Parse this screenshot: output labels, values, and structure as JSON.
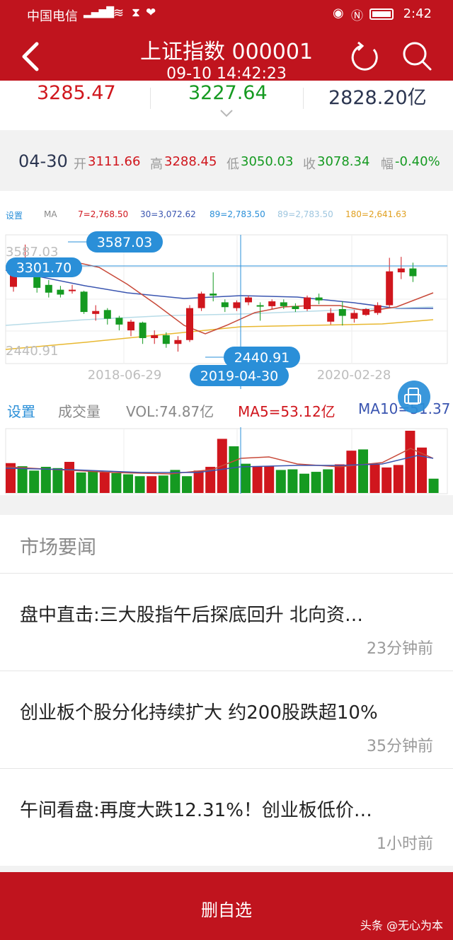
{
  "status": {
    "carrier": "中国电信",
    "time": "2:42"
  },
  "header": {
    "title": "上证指数 000001",
    "subtitle": "09-10 14:42:23"
  },
  "quote": {
    "price": "3285.47",
    "prev": "3227.64",
    "turnover": "2828.20亿"
  },
  "summary": {
    "date": "04-30",
    "open_label": "开",
    "open": "3111.66",
    "high_label": "高",
    "high": "3288.45",
    "low_label": "低",
    "low": "3050.03",
    "close_label": "收",
    "close": "3078.34",
    "change_label": "幅",
    "change": "-0.40%"
  },
  "ma_legend": {
    "settings": "设置",
    "ma": "MA",
    "ma7": "7=2,768.50",
    "ma30": "30=3,072.62",
    "ma89": "89=2,783.50",
    "ma89b": "89=2,783.50",
    "ma180": "180=2,641.63"
  },
  "kline": {
    "y_max_label": "3587.03",
    "y_min_label": "2440.91",
    "cross_value": "3301.70",
    "bubble_high": "3587.03",
    "bubble_low": "2440.91",
    "x_labels": [
      "2018-06-29",
      "2020-02-28"
    ],
    "cross_date": "2019-04-30"
  },
  "volume": {
    "settings": "设置",
    "type": "成交量",
    "vol": "VOL:74.87亿",
    "ma5": "MA5=53.12亿",
    "ma10": "MA10=51.37"
  },
  "news": {
    "section_title": "市场要闻",
    "items": [
      {
        "headline": "盘中直击:三大股指午后探底回升 北向资…",
        "time": "23分钟前"
      },
      {
        "headline": "创业板个股分化持续扩大 约200股跌超10%",
        "time": "35分钟前"
      },
      {
        "headline": "午间看盘:再度大跌12.31%！创业板低价…",
        "time": "1小时前"
      }
    ]
  },
  "footer": {
    "button": "删自选",
    "watermark": "头条 @无心为本"
  },
  "colors": {
    "brand_red": "#c0141e",
    "up": "#d0161d",
    "down": "#159a21",
    "accent_blue": "#2a8fd8"
  },
  "candles": [
    {
      "o": 3150,
      "c": 3300,
      "h": 3320,
      "l": 3100,
      "up": true
    },
    {
      "o": 3330,
      "c": 3350,
      "h": 3587,
      "l": 3300,
      "up": true
    },
    {
      "o": 3290,
      "c": 3140,
      "h": 3320,
      "l": 3090,
      "up": false
    },
    {
      "o": 3170,
      "c": 3090,
      "h": 3220,
      "l": 3040,
      "up": false
    },
    {
      "o": 3120,
      "c": 3070,
      "h": 3160,
      "l": 3040,
      "up": false
    },
    {
      "o": 3110,
      "c": 3120,
      "h": 3170,
      "l": 3080,
      "up": true
    },
    {
      "o": 3100,
      "c": 2890,
      "h": 3110,
      "l": 2870,
      "up": false
    },
    {
      "o": 2870,
      "c": 2900,
      "h": 2960,
      "l": 2800,
      "up": true
    },
    {
      "o": 2910,
      "c": 2820,
      "h": 2930,
      "l": 2760,
      "up": false
    },
    {
      "o": 2830,
      "c": 2760,
      "h": 2850,
      "l": 2700,
      "up": false
    },
    {
      "o": 2700,
      "c": 2790,
      "h": 2810,
      "l": 2640,
      "up": true
    },
    {
      "o": 2780,
      "c": 2620,
      "h": 2790,
      "l": 2560,
      "up": false
    },
    {
      "o": 2620,
      "c": 2650,
      "h": 2700,
      "l": 2560,
      "up": true
    },
    {
      "o": 2650,
      "c": 2560,
      "h": 2680,
      "l": 2520,
      "up": false
    },
    {
      "o": 2560,
      "c": 2600,
      "h": 2640,
      "l": 2480,
      "up": true
    },
    {
      "o": 2600,
      "c": 2930,
      "h": 2960,
      "l": 2580,
      "up": true
    },
    {
      "o": 2930,
      "c": 3080,
      "h": 3100,
      "l": 2900,
      "up": true
    },
    {
      "o": 3080,
      "c": 3060,
      "h": 3300,
      "l": 3000,
      "up": false
    },
    {
      "o": 2990,
      "c": 2940,
      "h": 3020,
      "l": 2890,
      "up": false
    },
    {
      "o": 2930,
      "c": 2990,
      "h": 3010,
      "l": 2900,
      "up": true
    },
    {
      "o": 2990,
      "c": 3040,
      "h": 3060,
      "l": 2960,
      "up": true
    },
    {
      "o": 2960,
      "c": 2950,
      "h": 2990,
      "l": 2800,
      "up": false
    },
    {
      "o": 2950,
      "c": 3000,
      "h": 3020,
      "l": 2920,
      "up": true
    },
    {
      "o": 2990,
      "c": 2950,
      "h": 3020,
      "l": 2920,
      "up": false
    },
    {
      "o": 2950,
      "c": 2920,
      "h": 2980,
      "l": 2890,
      "up": false
    },
    {
      "o": 2920,
      "c": 3040,
      "h": 3060,
      "l": 2900,
      "up": true
    },
    {
      "o": 3040,
      "c": 3010,
      "h": 3080,
      "l": 2970,
      "up": false
    },
    {
      "o": 2790,
      "c": 2880,
      "h": 2930,
      "l": 2760,
      "up": true
    },
    {
      "o": 2920,
      "c": 2850,
      "h": 3000,
      "l": 2750,
      "up": false
    },
    {
      "o": 2820,
      "c": 2880,
      "h": 2910,
      "l": 2780,
      "up": true
    },
    {
      "o": 2860,
      "c": 2920,
      "h": 2930,
      "l": 2850,
      "up": true
    },
    {
      "o": 2880,
      "c": 2960,
      "h": 2990,
      "l": 2860,
      "up": true
    },
    {
      "o": 2960,
      "c": 3310,
      "h": 3450,
      "l": 2940,
      "up": true
    },
    {
      "o": 3300,
      "c": 3340,
      "h": 3460,
      "l": 3230,
      "up": true
    },
    {
      "o": 3340,
      "c": 3260,
      "h": 3400,
      "l": 3200,
      "up": false
    }
  ],
  "volumes": [
    {
      "v": 48,
      "up": true
    },
    {
      "v": 43,
      "up": false
    },
    {
      "v": 36,
      "up": false
    },
    {
      "v": 42,
      "up": false
    },
    {
      "v": 40,
      "up": false
    },
    {
      "v": 50,
      "up": true
    },
    {
      "v": 33,
      "up": false
    },
    {
      "v": 36,
      "up": false
    },
    {
      "v": 33,
      "up": true
    },
    {
      "v": 32,
      "up": false
    },
    {
      "v": 30,
      "up": false
    },
    {
      "v": 27,
      "up": false
    },
    {
      "v": 27,
      "up": true
    },
    {
      "v": 28,
      "up": false
    },
    {
      "v": 37,
      "up": false
    },
    {
      "v": 27,
      "up": false
    },
    {
      "v": 36,
      "up": true
    },
    {
      "v": 42,
      "up": true
    },
    {
      "v": 87,
      "up": true
    },
    {
      "v": 75,
      "up": false
    },
    {
      "v": 47,
      "up": false
    },
    {
      "v": 43,
      "up": true
    },
    {
      "v": 43,
      "up": true
    },
    {
      "v": 37,
      "up": false
    },
    {
      "v": 38,
      "up": false
    },
    {
      "v": 31,
      "up": false
    },
    {
      "v": 34,
      "up": false
    },
    {
      "v": 38,
      "up": false
    },
    {
      "v": 46,
      "up": true
    },
    {
      "v": 68,
      "up": true
    },
    {
      "v": 70,
      "up": false
    },
    {
      "v": 47,
      "up": true
    },
    {
      "v": 41,
      "up": true
    },
    {
      "v": 45,
      "up": true
    },
    {
      "v": 100,
      "up": true
    },
    {
      "v": 73,
      "up": true
    },
    {
      "v": 23,
      "up": false
    }
  ]
}
